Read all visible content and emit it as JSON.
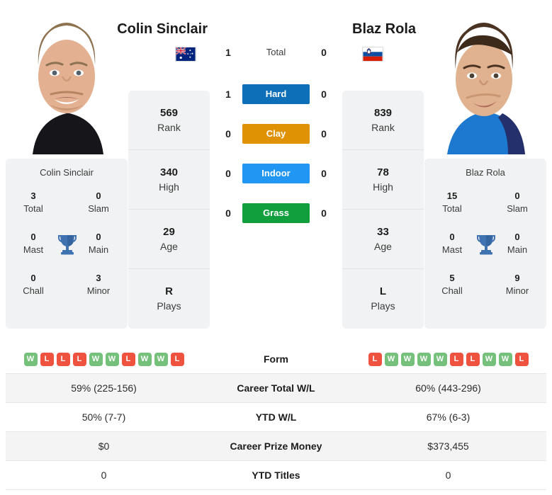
{
  "players": {
    "left": {
      "name": "Colin Sinclair",
      "card_name": "Colin Sinclair",
      "country": "Australia",
      "flag_icon": "flag-australia",
      "rank": "569",
      "high": "340",
      "age": "29",
      "plays": "R",
      "titles": {
        "total": "3",
        "slam": "0",
        "mast": "0",
        "main": "0",
        "chall": "0",
        "minor": "3"
      },
      "h2h": {
        "total": "1",
        "hard": "1",
        "clay": "0",
        "indoor": "0",
        "grass": "0"
      },
      "form": [
        "W",
        "L",
        "L",
        "L",
        "W",
        "W",
        "L",
        "W",
        "W",
        "L"
      ],
      "career_wl": "59% (225-156)",
      "ytd_wl": "50% (7-7)",
      "career_prize": "$0",
      "ytd_titles": "0"
    },
    "right": {
      "name": "Blaz Rola",
      "card_name": "Blaz Rola",
      "country": "Slovenia",
      "flag_icon": "flag-slovenia",
      "rank": "839",
      "high": "78",
      "age": "33",
      "plays": "L",
      "titles": {
        "total": "15",
        "slam": "0",
        "mast": "0",
        "main": "0",
        "chall": "5",
        "minor": "9"
      },
      "h2h": {
        "total": "0",
        "hard": "0",
        "clay": "0",
        "indoor": "0",
        "grass": "0"
      },
      "form": [
        "L",
        "W",
        "W",
        "W",
        "W",
        "L",
        "L",
        "W",
        "W",
        "L"
      ],
      "career_wl": "60% (443-296)",
      "ytd_wl": "67% (6-3)",
      "career_prize": "$373,455",
      "ytd_titles": "0"
    }
  },
  "labels": {
    "rank": "Rank",
    "high": "High",
    "age": "Age",
    "plays": "Plays",
    "total": "Total",
    "slam": "Slam",
    "mast": "Mast",
    "main": "Main",
    "chall": "Chall",
    "minor": "Minor",
    "trophy_icon": "trophy-icon"
  },
  "surfaces": [
    {
      "key": "total",
      "label": "Total",
      "color": "transparent",
      "filled": false
    },
    {
      "key": "hard",
      "label": "Hard",
      "color": "#0d6fb8",
      "filled": true
    },
    {
      "key": "clay",
      "label": "Clay",
      "color": "#e09205",
      "filled": true
    },
    {
      "key": "indoor",
      "label": "Indoor",
      "color": "#2196f3",
      "filled": true
    },
    {
      "key": "grass",
      "label": "Grass",
      "color": "#119e3d",
      "filled": true
    }
  ],
  "table": {
    "form_label": "Form",
    "rows": [
      {
        "label": "Career Total W/L",
        "left": "59% (225-156)",
        "right": "60% (443-296)"
      },
      {
        "label": "YTD W/L",
        "left": "50% (7-7)",
        "right": "67% (6-3)"
      },
      {
        "label": "Career Prize Money",
        "left": "$0",
        "right": "$373,455"
      },
      {
        "label": "YTD Titles",
        "left": "0",
        "right": "0"
      }
    ]
  },
  "colors": {
    "win": "#75c07b",
    "loss": "#ef5340",
    "card_bg": "#f1f2f3",
    "trophy": "#3f72b0"
  }
}
